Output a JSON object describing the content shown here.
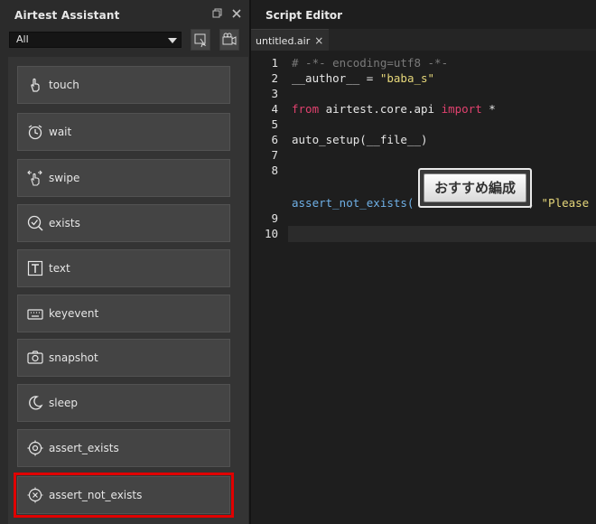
{
  "assistant": {
    "title": "Airtest Assistant",
    "restore_icon": "restore-icon",
    "close_icon": "close-icon",
    "filter": {
      "selected": "All"
    },
    "tool_buttons": [
      "capture-icon",
      "record-icon"
    ],
    "items": [
      {
        "label": "touch",
        "icon": "touch-icon"
      },
      {
        "label": "wait",
        "icon": "clock-icon"
      },
      {
        "label": "swipe",
        "icon": "swipe-icon"
      },
      {
        "label": "exists",
        "icon": "check-circle-icon"
      },
      {
        "label": "text",
        "icon": "text-icon"
      },
      {
        "label": "keyevent",
        "icon": "keyboard-icon"
      },
      {
        "label": "snapshot",
        "icon": "camera-icon"
      },
      {
        "label": "sleep",
        "icon": "moon-icon"
      },
      {
        "label": "assert_exists",
        "icon": "target-icon"
      },
      {
        "label": "assert_not_exists",
        "icon": "circle-x-icon",
        "highlighted": true
      }
    ]
  },
  "editor": {
    "title": "Script Editor",
    "tab": {
      "label": "untitled.air",
      "close": "×"
    },
    "line_numbers": [
      "1",
      "2",
      "3",
      "4",
      "5",
      "6",
      "7",
      "8",
      "9",
      "10"
    ],
    "code": {
      "l1": "# -*- encoding=utf8 -*-",
      "l2_a": "__author__ = ",
      "l2_b": "\"baba_s\"",
      "l4_kw1": "from",
      "l4_mod": " airtest.core.api ",
      "l4_kw2": "import",
      "l4_rest": " *",
      "l6": "auto_setup(__file__)",
      "l8_fn": "assert_not_exists(",
      "l8_sep": ", ",
      "l8_str": "\"Please"
    },
    "image_arg_text": "おすすめ編成"
  }
}
